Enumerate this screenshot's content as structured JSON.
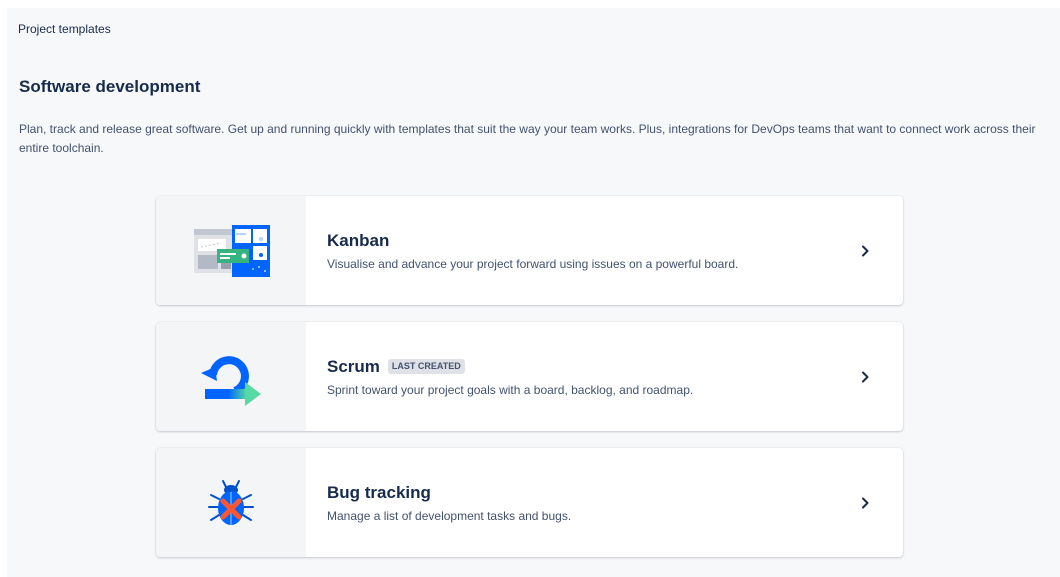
{
  "breadcrumb": "Project templates",
  "section": {
    "title": "Software development",
    "description": "Plan, track and release great software. Get up and running quickly with templates that suit the way your team works. Plus, integrations for DevOps teams that want to connect work across their entire toolchain."
  },
  "templates": [
    {
      "title": "Kanban",
      "description": "Visualise and advance your project forward using issues on a powerful board.",
      "icon": "kanban-board-illustration"
    },
    {
      "title": "Scrum",
      "badge": "LAST CREATED",
      "description": "Sprint toward your project goals with a board, backlog, and roadmap.",
      "icon": "scrum-sprint-illustration"
    },
    {
      "title": "Bug tracking",
      "description": "Manage a list of development tasks and bugs.",
      "icon": "bug-illustration"
    }
  ],
  "colors": {
    "accent_blue": "#0065ff",
    "green": "#36b37e",
    "red": "#ff5630",
    "text_primary": "#172b4d",
    "text_secondary": "#42526e"
  }
}
